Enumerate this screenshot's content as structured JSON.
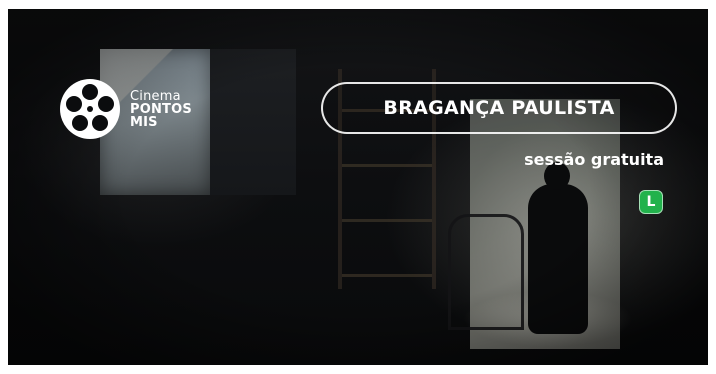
{
  "logo": {
    "line1": "Cinema",
    "line2": "PONTOS",
    "line3": "MIS",
    "icon": "film-reel-icon"
  },
  "location": {
    "label": "BRAGANÇA PAULISTA"
  },
  "session": {
    "label": "sessão gratuita"
  },
  "rating": {
    "label": "L",
    "color": "#22b24c"
  },
  "colors": {
    "text": "#ffffff",
    "background": "#0b0c0e"
  }
}
